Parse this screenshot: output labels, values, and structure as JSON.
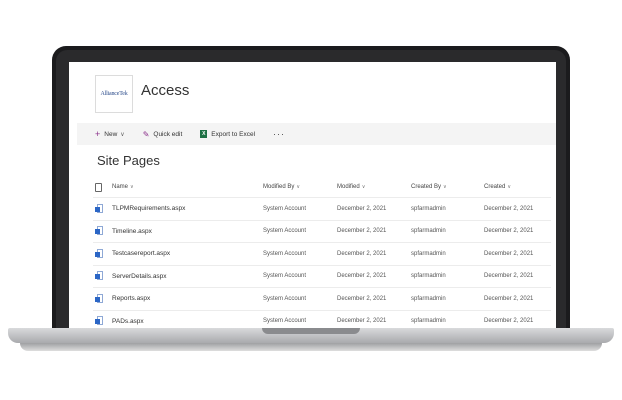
{
  "site": {
    "logo_text": "AllianceTek",
    "title": "Access"
  },
  "commandbar": {
    "new_label": "New",
    "quick_edit_label": "Quick edit",
    "export_label": "Export to Excel",
    "more_label": "···"
  },
  "page": {
    "title": "Site Pages"
  },
  "table": {
    "columns": [
      "Name",
      "Modified By",
      "Modified",
      "Created By",
      "Created"
    ],
    "rows": [
      {
        "name": "TLPMRequirements.aspx",
        "modified_by": "System Account",
        "modified": "December 2, 2021",
        "created_by": "spfarmadmin",
        "created": "December 2, 2021"
      },
      {
        "name": "Timeline.aspx",
        "modified_by": "System Account",
        "modified": "December 2, 2021",
        "created_by": "spfarmadmin",
        "created": "December 2, 2021"
      },
      {
        "name": "Testcasereport.aspx",
        "modified_by": "System Account",
        "modified": "December 2, 2021",
        "created_by": "spfarmadmin",
        "created": "December 2, 2021"
      },
      {
        "name": "ServerDetails.aspx",
        "modified_by": "System Account",
        "modified": "December 2, 2021",
        "created_by": "spfarmadmin",
        "created": "December 2, 2021"
      },
      {
        "name": "Reports.aspx",
        "modified_by": "System Account",
        "modified": "December 2, 2021",
        "created_by": "spfarmadmin",
        "created": "December 2, 2021"
      },
      {
        "name": "PADs.aspx",
        "modified_by": "System Account",
        "modified": "December 2, 2021",
        "created_by": "spfarmadmin",
        "created": "December 2, 2021"
      }
    ]
  },
  "icons": {
    "new": "plus-icon",
    "quick_edit": "pencil-icon",
    "export": "excel-icon",
    "file": "aspx-page-icon",
    "doc_header": "document-icon"
  },
  "colors": {
    "accent": "#8a2f8a",
    "excel": "#1e7145",
    "file": "#2b66c6"
  }
}
